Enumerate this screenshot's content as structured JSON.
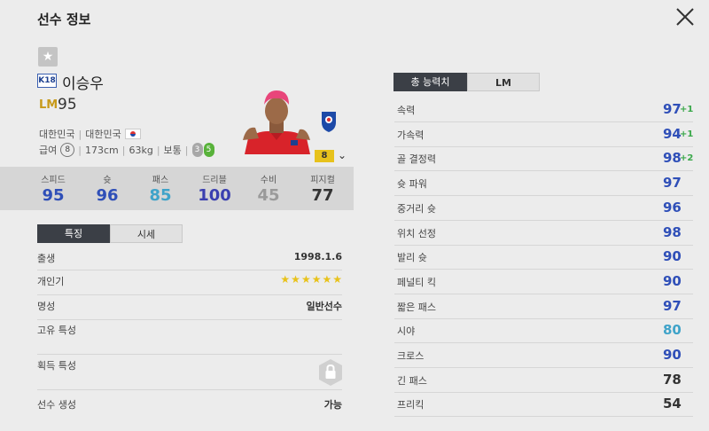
{
  "header": {
    "title": "선수 정보"
  },
  "player": {
    "season_badge": "K18",
    "name": "이승우",
    "position": "LM",
    "overall": "95",
    "nation": "대한민국",
    "team": "대한민국",
    "salary_label": "급여",
    "salary": "8",
    "height": "173cm",
    "weight": "63kg",
    "body_type": "보통",
    "weak_foot": "3",
    "strong_foot": "5",
    "grade": "8"
  },
  "summary_stats": [
    {
      "label": "스피드",
      "value": "95",
      "color": "#2f4fb8"
    },
    {
      "label": "슛",
      "value": "96",
      "color": "#2f4fb8"
    },
    {
      "label": "패스",
      "value": "85",
      "color": "#3fa3c9"
    },
    {
      "label": "드리블",
      "value": "100",
      "color": "#3a3fb0"
    },
    {
      "label": "수비",
      "value": "45",
      "color": "#9a9a9a"
    },
    {
      "label": "피지컬",
      "value": "77",
      "color": "#333333"
    }
  ],
  "left_tabs": {
    "active": "특징",
    "inactive": "시세"
  },
  "info": {
    "birth_label": "출생",
    "birth": "1998.1.6",
    "popularity_label": "개인기",
    "popularity_stars": 6,
    "fame_label": "명성",
    "fame": "일반선수",
    "unique_traits_label": "고유 특성",
    "acquired_traits_label": "획득 특성",
    "generation_label": "선수 생성",
    "generation": "가능"
  },
  "right_tabs": {
    "active": "총 능력치",
    "inactive": "LM"
  },
  "attributes": [
    {
      "label": "속력",
      "value": "97",
      "bonus": "+1",
      "color": "#2f4fb8"
    },
    {
      "label": "가속력",
      "value": "94",
      "bonus": "+1",
      "color": "#2f4fb8"
    },
    {
      "label": "골 결정력",
      "value": "98",
      "bonus": "+2",
      "color": "#2f4fb8"
    },
    {
      "label": "슛 파워",
      "value": "97",
      "bonus": "",
      "color": "#2f4fb8"
    },
    {
      "label": "중거리 슛",
      "value": "96",
      "bonus": "",
      "color": "#2f4fb8"
    },
    {
      "label": "위치 선정",
      "value": "98",
      "bonus": "",
      "color": "#2f4fb8"
    },
    {
      "label": "발리 슛",
      "value": "90",
      "bonus": "",
      "color": "#2f4fb8"
    },
    {
      "label": "페널티 킥",
      "value": "90",
      "bonus": "",
      "color": "#2f4fb8"
    },
    {
      "label": "짧은 패스",
      "value": "97",
      "bonus": "",
      "color": "#2f4fb8"
    },
    {
      "label": "시야",
      "value": "80",
      "bonus": "",
      "color": "#3fa3c9"
    },
    {
      "label": "크로스",
      "value": "90",
      "bonus": "",
      "color": "#2f4fb8"
    },
    {
      "label": "긴 패스",
      "value": "78",
      "bonus": "",
      "color": "#333333"
    },
    {
      "label": "프리킥",
      "value": "54",
      "bonus": "",
      "color": "#333333"
    }
  ]
}
